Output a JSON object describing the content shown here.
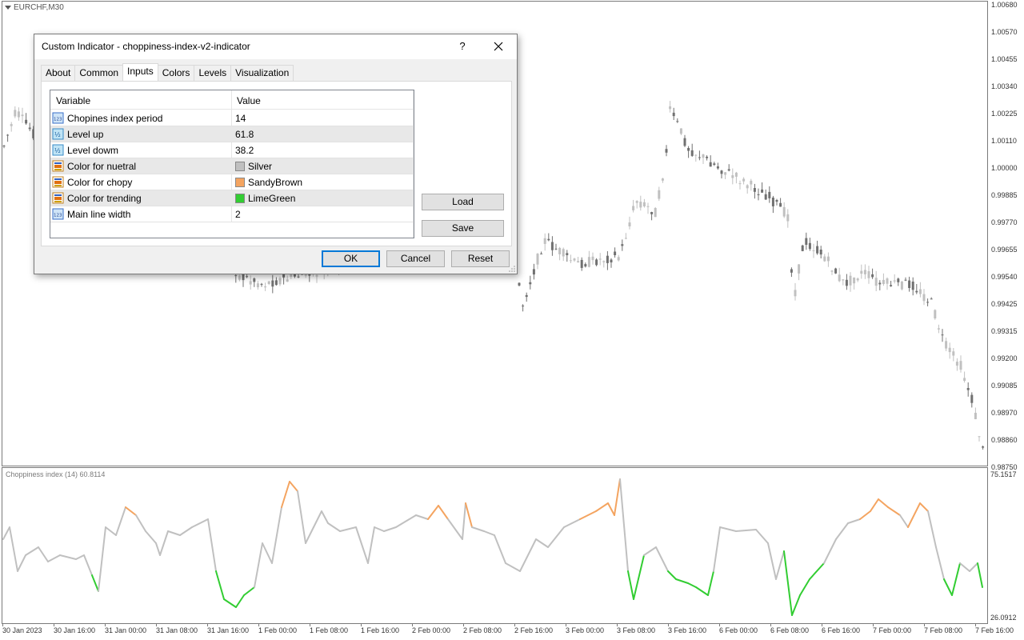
{
  "chart": {
    "symbol": "EURCHF,M30",
    "price_axis": [
      "1.00680",
      "1.00570",
      "1.00455",
      "1.00340",
      "1.00225",
      "1.00110",
      "1.00000",
      "0.99885",
      "0.99770",
      "0.99655",
      "0.99540",
      "0.99425",
      "0.99315",
      "0.99200",
      "0.99085",
      "0.98970",
      "0.98860",
      "0.98750"
    ],
    "time_axis": [
      "30 Jan 2023",
      "30 Jan 16:00",
      "31 Jan 00:00",
      "31 Jan 08:00",
      "31 Jan 16:00",
      "1 Feb 00:00",
      "1 Feb 08:00",
      "1 Feb 16:00",
      "2 Feb 00:00",
      "2 Feb 08:00",
      "2 Feb 16:00",
      "3 Feb 00:00",
      "3 Feb 08:00",
      "3 Feb 16:00",
      "6 Feb 00:00",
      "6 Feb 08:00",
      "6 Feb 16:00",
      "7 Feb 00:00",
      "7 Feb 08:00",
      "7 Feb 16:00"
    ],
    "bullish_color": "#c0c0c0",
    "bearish_color": "#707070"
  },
  "indicator": {
    "title": "Choppiness index (14) 60.8114",
    "axis_max": "75.1517",
    "axis_min": "26.0912",
    "colors": {
      "neutral": "#c0c0c0",
      "choppy": "#f4a460",
      "trending": "#32cd32"
    }
  },
  "dialog": {
    "title": "Custom Indicator - choppiness-index-v2-indicator",
    "help": "?",
    "tabs": [
      "About",
      "Common",
      "Inputs",
      "Colors",
      "Levels",
      "Visualization"
    ],
    "active_tab": "Inputs",
    "grid": {
      "headers": {
        "variable": "Variable",
        "value": "Value"
      },
      "rows": [
        {
          "icon": "int-icon",
          "variable": "Chopines index period",
          "value": "14"
        },
        {
          "icon": "double-icon",
          "variable": "Level up",
          "value": "61.8"
        },
        {
          "icon": "double-icon",
          "variable": "Level dowm",
          "value": "38.2"
        },
        {
          "icon": "color-icon",
          "variable": "Color for nuetral",
          "value": "Silver",
          "swatch": "#c0c0c0"
        },
        {
          "icon": "color-icon",
          "variable": "Color for chopy",
          "value": "SandyBrown",
          "swatch": "#f4a460"
        },
        {
          "icon": "color-icon",
          "variable": "Color for trending",
          "value": "LimeGreen",
          "swatch": "#32cd32"
        },
        {
          "icon": "int-icon",
          "variable": "Main line width",
          "value": "2"
        }
      ]
    },
    "buttons": {
      "load": "Load",
      "save": "Save",
      "ok": "OK",
      "cancel": "Cancel",
      "reset": "Reset"
    }
  }
}
